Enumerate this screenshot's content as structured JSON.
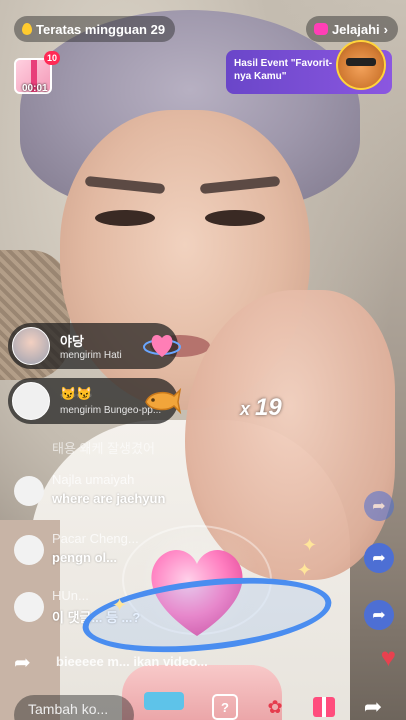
{
  "top": {
    "weekly_label": "Teratas mingguan 29",
    "explore_label": "Jelajahi",
    "gift_badge_count": "10",
    "gift_timer": "00:01",
    "event_text": "Hasil Event \"Favorit-nya Kamu\""
  },
  "gift_notifications": [
    {
      "name": "야당",
      "action": "mengirim Hati"
    },
    {
      "name": "😼😼",
      "action": "mengirim Bungeo-pp..."
    }
  ],
  "gift_multiplier": "19",
  "faded_comment": "태용 왜케 잘생겼어",
  "comments": [
    {
      "name": "Najla umaiyah",
      "text": "where are jaehyun"
    },
    {
      "name": "Pacar Cheng...",
      "text": "pengn ol..."
    },
    {
      "name": "HUn...",
      "text": "이 댓글... 등 ...?"
    }
  ],
  "bottom_comment": "bieeeee m... ikan video...",
  "input_placeholder": "Tambah ko...",
  "colors": {
    "accent": "#4d6fd4",
    "event_bg": "#6a46c9",
    "badge": "#ff2a55"
  }
}
